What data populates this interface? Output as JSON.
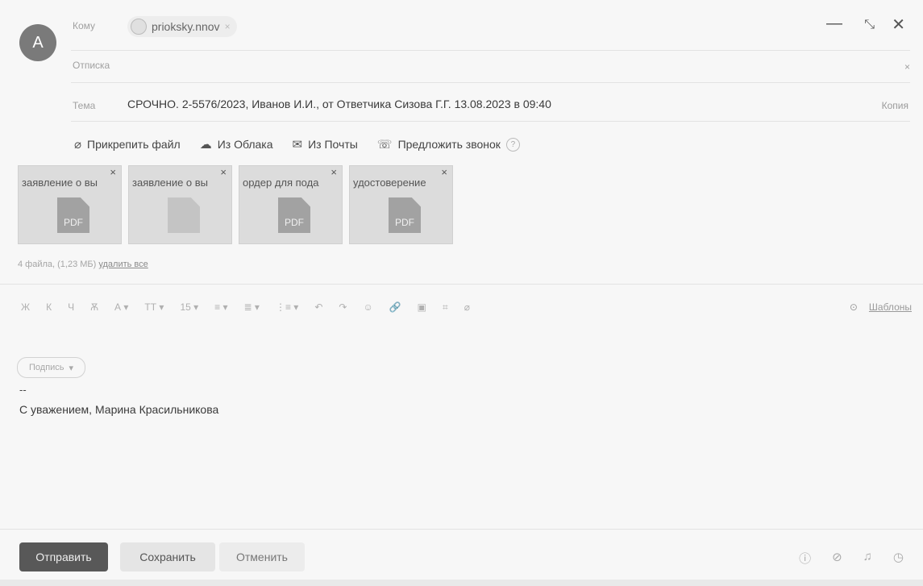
{
  "compose": {
    "avatar_letter": "A",
    "to_label": "Кому",
    "recipient": "prioksky.nnov",
    "recipient_remove": "×",
    "from_label": "Отписка",
    "from_close": "×",
    "subject_label": "Тема",
    "subject": "СРОЧНО. 2-5576/2023, Иванов И.И., от Ответчика Сизова Г.Г. 13.08.2023 в 09:40",
    "copy_link": "Копия"
  },
  "window_controls": {
    "minimize": "—",
    "expand": "⤡",
    "close": "✕"
  },
  "attach_toolbar": [
    {
      "icon": "paperclip-icon",
      "glyph": "⌀",
      "label": "Прикрепить файл"
    },
    {
      "icon": "cloud-icon",
      "glyph": "☁",
      "label": "Из Облака"
    },
    {
      "icon": "mail-icon",
      "glyph": "✉",
      "label": "Из Почты"
    },
    {
      "icon": "video-call-icon",
      "glyph": "☏",
      "label": "Предложить звонок"
    }
  ],
  "attach_help": "?",
  "attachments": [
    {
      "name": "заявление о вы",
      "type": "pdf",
      "badge": "PDF"
    },
    {
      "name": "заявление о вы",
      "type": "doc",
      "badge": ""
    },
    {
      "name": "ордер для пода",
      "type": "pdf",
      "badge": "PDF"
    },
    {
      "name": "удостоверение",
      "type": "pdf",
      "badge": "PDF"
    }
  ],
  "attachment_remove": "×",
  "files_info": {
    "summary": "4 файла, (1,23 МБ)",
    "delete_all": "удалить все"
  },
  "format_toolbar": [
    "Ж",
    "К",
    "Ч",
    "Ѫ",
    "А ▾",
    "ТТ ▾",
    "15 ▾",
    "≡ ▾",
    "≣ ▾",
    "⋮≡ ▾",
    "↶",
    "↷",
    "☺",
    "🔗",
    "▣",
    "⌗",
    "⌀"
  ],
  "templates": {
    "icon_glyph": "⊙",
    "label": "Шаблоны"
  },
  "fill_button": {
    "label": "Подпись",
    "chevron": "▾"
  },
  "body": {
    "signature_dash": "--",
    "signature": "С уважением, Марина Красильникова"
  },
  "footer": {
    "send": "Отправить",
    "save": "Сохранить",
    "cancel": "Отменить",
    "icons": [
      {
        "icon": "important-icon",
        "glyph": "ⓘ"
      },
      {
        "icon": "notify-icon",
        "glyph": "⊘"
      },
      {
        "icon": "reminder-bell-icon",
        "glyph": "♫"
      },
      {
        "icon": "schedule-clock-icon",
        "glyph": "◷"
      }
    ]
  }
}
